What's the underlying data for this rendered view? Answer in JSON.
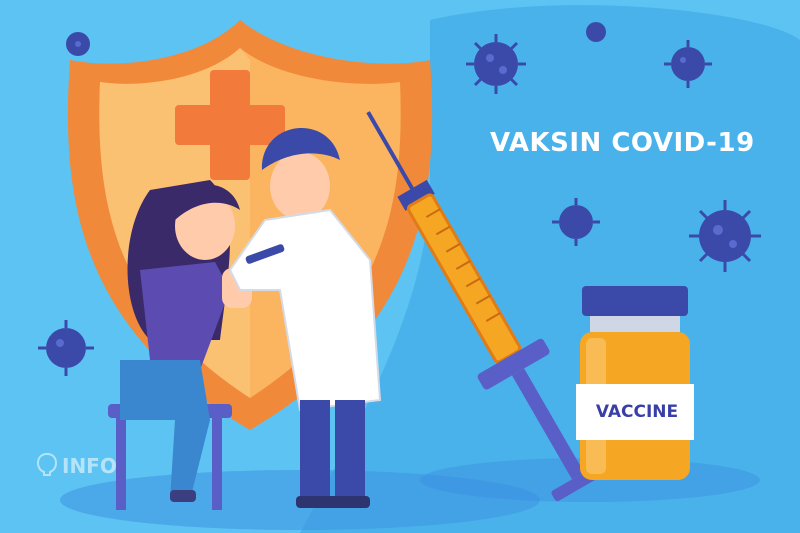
{
  "headline": "VAKSIN COVID-19",
  "vial_label": "VACCINE",
  "watermark": "INFO",
  "icons": [
    "virus-icon",
    "shield-icon",
    "cross-icon",
    "syringe-icon",
    "vaccine-vial-icon",
    "brain-logo-icon"
  ],
  "colors": {
    "background": "#5cc3f3",
    "background_blob": "#3ea6e6",
    "shield_outer": "#f08a3a",
    "shield_inner": "#fbb45f",
    "cross": "#f27a3a",
    "virus": "#3b4aa8",
    "text": "#ffffff",
    "vial_label_text": "#3a3fa8"
  }
}
